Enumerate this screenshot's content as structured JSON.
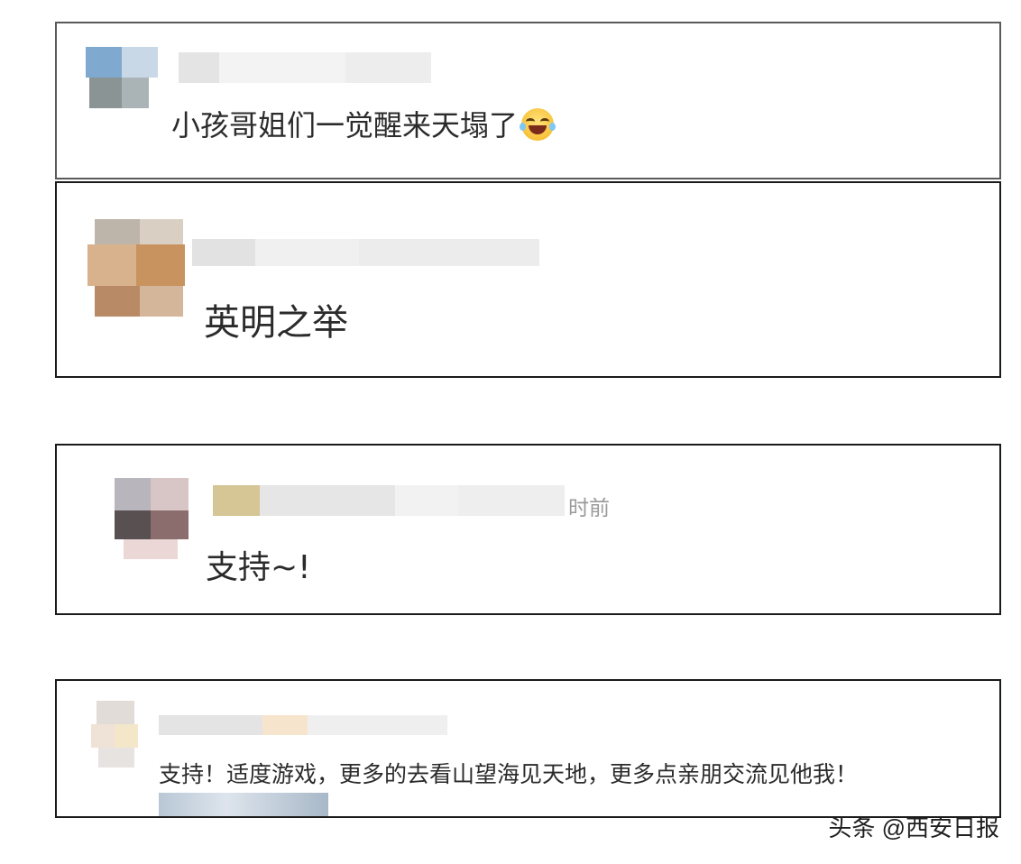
{
  "comments": [
    {
      "text": "小孩哥姐们一觉醒来天塌了",
      "has_emoji": true,
      "emoji": "laughing-tears-icon"
    },
    {
      "text": "英明之举"
    },
    {
      "text": "支持~!",
      "time_suffix": "时前"
    },
    {
      "text": "支持！适度游戏，更多的去看山望海见天地，更多点亲朋交流见他我！"
    }
  ],
  "watermark": "头条 @西安日报",
  "colors": {
    "border": "#1a1a1a",
    "text": "#2b2b2b",
    "muted": "#9a9a9a"
  }
}
